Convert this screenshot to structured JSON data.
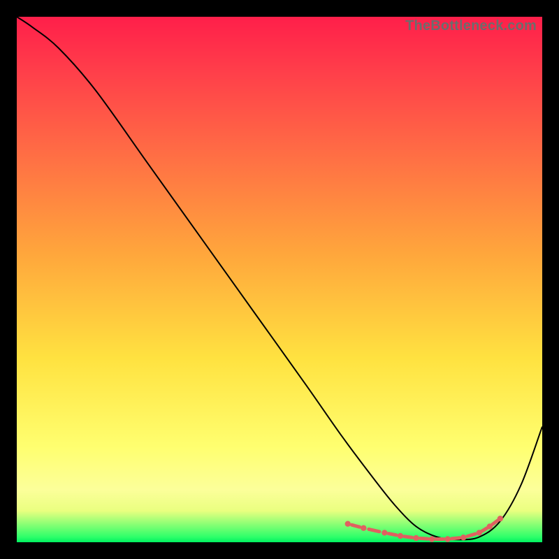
{
  "watermark": "TheBottleneck.com",
  "chart_data": {
    "type": "line",
    "title": "",
    "xlabel": "",
    "ylabel": "",
    "xlim": [
      0,
      100
    ],
    "ylim": [
      0,
      100
    ],
    "x": [
      0,
      3,
      8,
      15,
      25,
      35,
      45,
      55,
      62,
      68,
      72,
      76,
      80,
      84,
      88,
      92,
      96,
      100
    ],
    "y": [
      100,
      98,
      94,
      86,
      72,
      58,
      44,
      30,
      20,
      12,
      7,
      3,
      1,
      0.5,
      1,
      4,
      11,
      22
    ],
    "markers": {
      "x": [
        63,
        66,
        70,
        73,
        76,
        79,
        82,
        85,
        88,
        90,
        92
      ],
      "y": [
        3.5,
        2.7,
        1.8,
        1.2,
        0.8,
        0.6,
        0.6,
        0.9,
        1.8,
        3,
        4.5
      ]
    },
    "background_gradient": [
      "#ff1f4a",
      "#ff6a45",
      "#ffe240",
      "#fcff9a",
      "#00f060"
    ]
  }
}
